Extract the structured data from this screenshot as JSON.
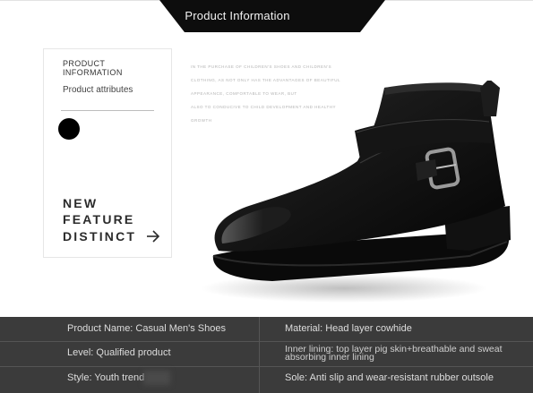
{
  "banner": {
    "title": "Product Information"
  },
  "card": {
    "title_line1": "PRODUCT",
    "title_line2": "INFORMATION",
    "subtitle": "Product attributes",
    "feature_lines": [
      "NEW",
      "FEATURE",
      "DISTINCT"
    ],
    "arrow_icon": "arrow-right-icon"
  },
  "description": {
    "lines": [
      "IN THE PURCHASE OF CHILDREN'S SHOES AND CHILDREN'S",
      "CLOTHING, AS NOT ONLY HAS THE ADVANTAGES OF BEAUTIFUL",
      "APPEARANCE, COMFORTABLE TO WEAR, BUT",
      "ALSO TO CONDUCIVE TO CHILD DEVELOPMENT AND HEALTHY",
      "GROWTH"
    ]
  },
  "product_image": "black-leather-ankle-boot-with-buckle-strap",
  "specs": {
    "product_name": "Product Name: Casual Men's Shoes",
    "material": "Material: Head layer cowhide",
    "level": "Level: Qualified product",
    "inner_lining": "Inner lining: top layer pig skin+breathable and sweat absorbing inner lining",
    "style": "Style: Youth trend",
    "sole": "Sole: Anti slip and wear-resistant rubber outsole"
  },
  "colors": {
    "banner": "#0d0d0d",
    "spec_background": "#3b3b3b",
    "spec_text": "#dddddd",
    "feature_text": "#2b2b2b"
  }
}
